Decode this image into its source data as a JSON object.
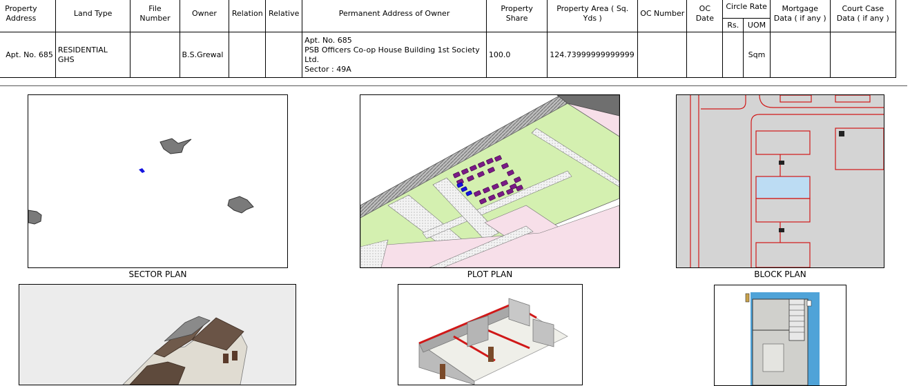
{
  "table": {
    "headers": {
      "property_address": "Property Address",
      "land_type": "Land Type",
      "file_number": "File Number",
      "owner": "Owner",
      "relation": "Relation",
      "relative": "Relative",
      "permanent_address": "Permanent Address of Owner",
      "property_share": "Property Share",
      "property_area": "Property Area ( Sq. Yds )",
      "oc_number": "OC Number",
      "oc_date": "OC Date",
      "circle_rate": "Circle Rate",
      "rs": "Rs.",
      "uom": "UOM",
      "mortgage": "Mortgage Data ( if any )",
      "court_case": "Court Case Data ( if any )"
    },
    "row": {
      "property_address": "Apt. No. 685",
      "land_type_line1": "RESIDENTIAL",
      "land_type_line2": "GHS",
      "file_number": "",
      "owner": "B.S.Grewal",
      "relation": "",
      "relative": "",
      "address_line1": "Apt. No. 685",
      "address_line2": "PSB Officers Co-op House Building 1st Society Ltd.",
      "address_line3": "Sector : 49A",
      "property_share": "100.0",
      "property_area": "124.73999999999999",
      "oc_number": "",
      "oc_date": "",
      "rs": "",
      "uom": "Sqm",
      "mortgage": "",
      "court_case": ""
    }
  },
  "plans": {
    "sector": "SECTOR PLAN",
    "plot": "PLOT PLAN",
    "block": "BLOCK PLAN"
  }
}
